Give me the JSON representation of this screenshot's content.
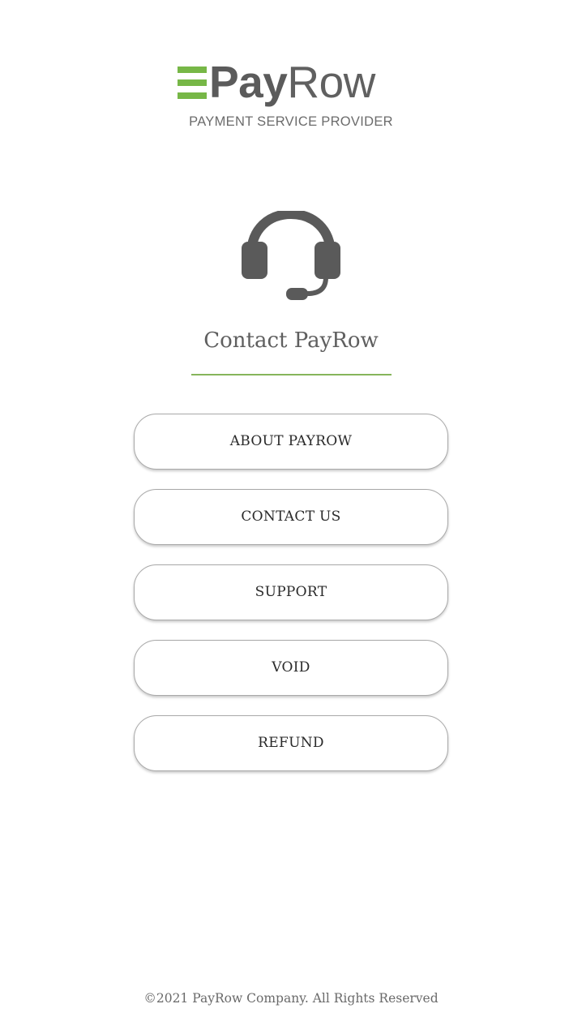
{
  "brand": {
    "name_bold": "Pay",
    "name_light": "Row",
    "tagline": "PAYMENT SERVICE PROVIDER",
    "accent_color": "#77b747",
    "text_color": "#5b5b5b"
  },
  "header": {
    "icon": "headset-icon",
    "title": "Contact PayRow"
  },
  "menu": {
    "items": [
      {
        "label": "ABOUT PAYROW"
      },
      {
        "label": "CONTACT US"
      },
      {
        "label": "SUPPORT"
      },
      {
        "label": "VOID"
      },
      {
        "label": "REFUND"
      }
    ]
  },
  "footer": {
    "copyright": "©2021 PayRow Company. All Rights Reserved"
  }
}
